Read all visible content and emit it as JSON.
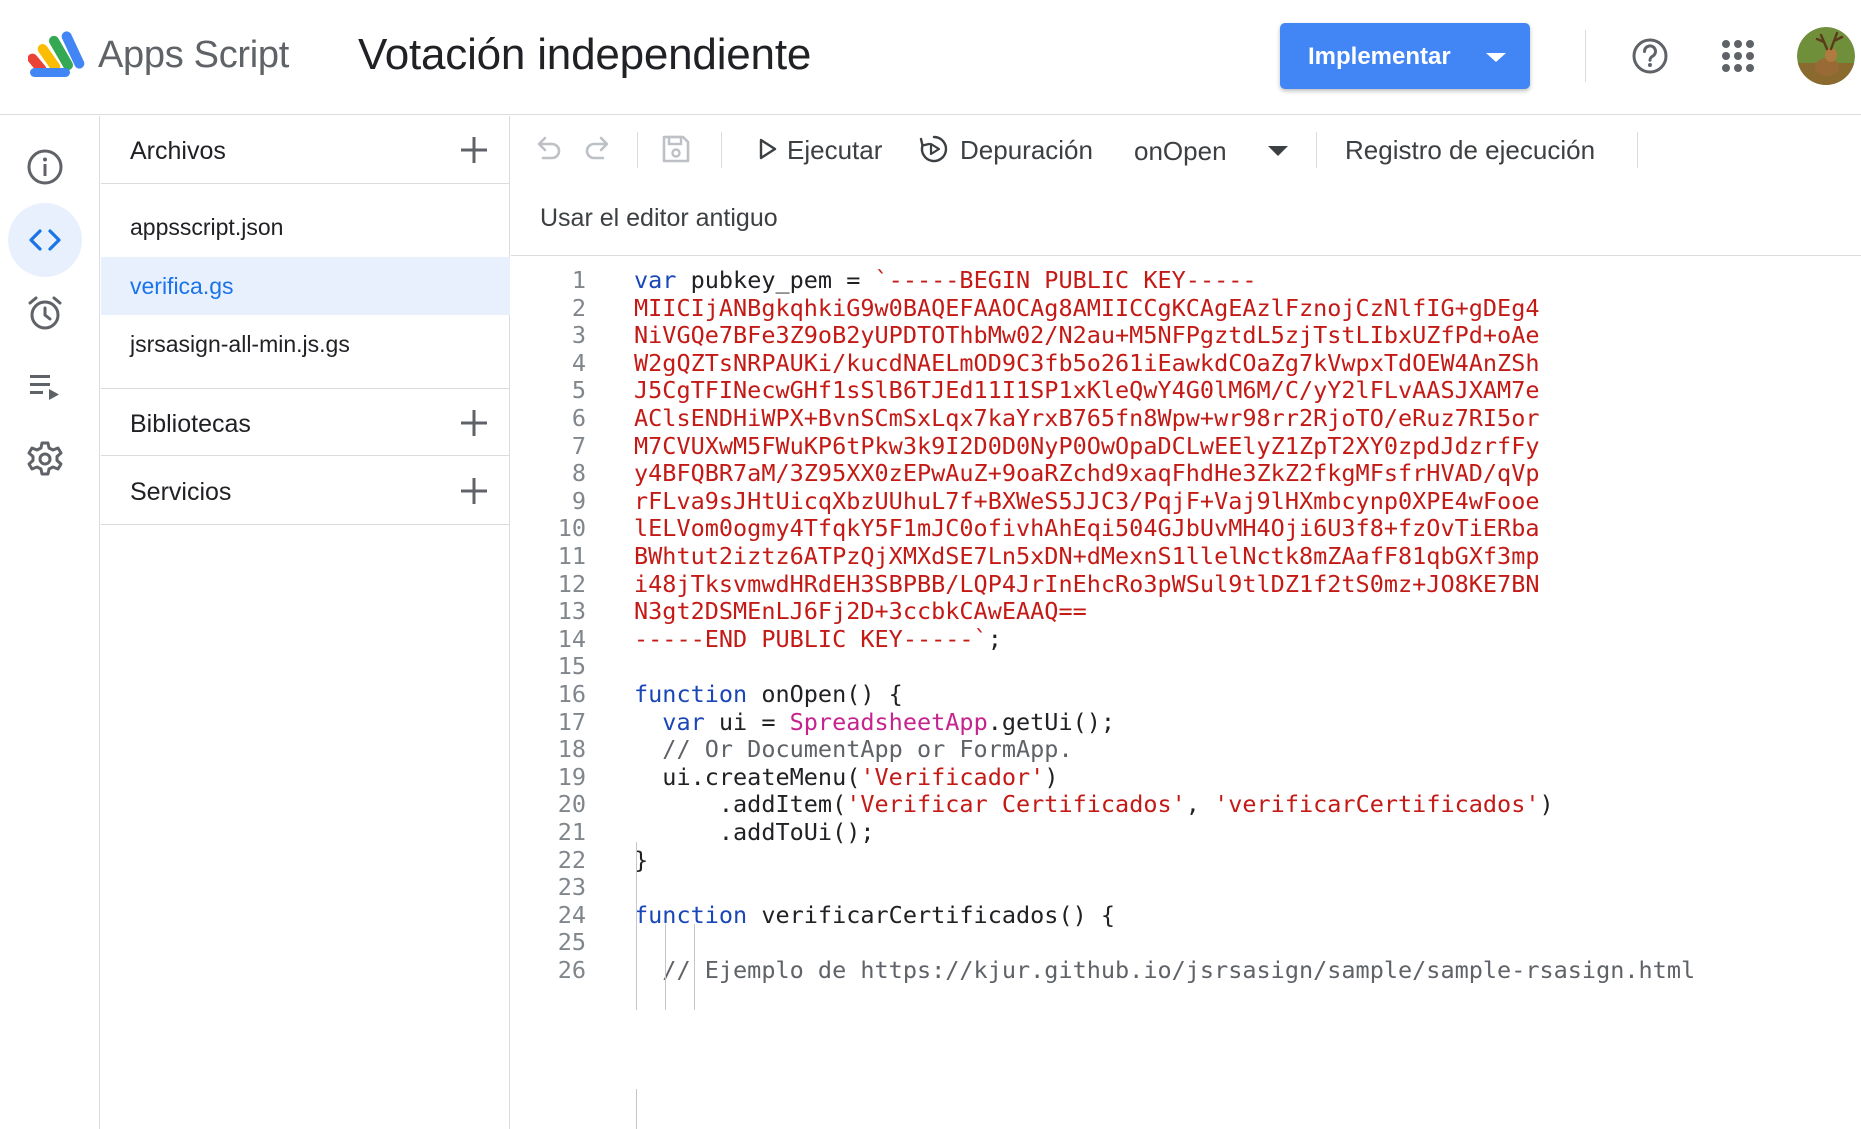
{
  "header": {
    "app_name": "Apps Script",
    "project_title": "Votación independiente",
    "deploy_label": "Implementar"
  },
  "rail": {
    "items": [
      "overview-icon",
      "code-icon",
      "triggers-icon",
      "executions-icon",
      "settings-icon"
    ],
    "active": "code-icon"
  },
  "files_panel": {
    "files_header": "Archivos",
    "files": [
      "appsscript.json",
      "verifica.gs",
      "jsrsasign-all-min.js.gs"
    ],
    "active_file": "verifica.gs",
    "libraries_header": "Bibliotecas",
    "services_header": "Servicios"
  },
  "toolbar": {
    "run_label": "Ejecutar",
    "debug_label": "Depuración",
    "function_select": "onOpen",
    "execution_log_label": "Registro de ejecución",
    "legacy_editor_label": "Usar el editor antiguo"
  },
  "colors": {
    "accent": "#1a73e8",
    "deploy_button": "#4285f4",
    "keyword": "#1a47b8",
    "string": "#c41a16",
    "class": "#c5238e"
  },
  "code": {
    "line_numbers": [
      "1",
      "2",
      "3",
      "4",
      "5",
      "6",
      "7",
      "8",
      "9",
      "10",
      "11",
      "12",
      "13",
      "14",
      "15",
      "16",
      "17",
      "18",
      "19",
      "20",
      "21",
      "22",
      "23",
      "24",
      "25",
      "26"
    ],
    "lines": [
      [
        {
          "t": "var",
          "c": "kw"
        },
        {
          "t": " pubkey_pem = "
        },
        {
          "t": "`-----BEGIN PUBLIC KEY-----",
          "c": "str"
        }
      ],
      [
        {
          "t": "MIICIjANBgkqhkiG9w0BAQEFAAOCAg8AMIICCgKCAgEAzlFznojCzNlfIG+gDEg4",
          "c": "str"
        }
      ],
      [
        {
          "t": "NiVGQe7BFe3Z9oB2yUPDTOThbMw02/N2au+M5NFPgztdL5zjTstLIbxUZfPd+oAe",
          "c": "str"
        }
      ],
      [
        {
          "t": "W2gQZTsNRPAUKi/kucdNAELmOD9C3fb5o261iEawkdCOaZg7kVwpxTdOEW4AnZSh",
          "c": "str"
        }
      ],
      [
        {
          "t": "J5CgTFINecwGHf1sSlB6TJEd11I1SP1xKleQwY4G0lM6M/C/yY2lFLvAASJXAM7e",
          "c": "str"
        }
      ],
      [
        {
          "t": "AClsENDHiWPX+BvnSCmSxLqx7kaYrxB765fn8Wpw+wr98rr2RjoTO/eRuz7RI5or",
          "c": "str"
        }
      ],
      [
        {
          "t": "M7CVUXwM5FWuKP6tPkw3k9I2D0D0NyP0OwOpaDCLwEElyZ1ZpT2XY0zpdJdzrfFy",
          "c": "str"
        }
      ],
      [
        {
          "t": "y4BFQBR7aM/3Z95XX0zEPwAuZ+9oaRZchd9xaqFhdHe3ZkZ2fkgMFsfrHVAD/qVp",
          "c": "str"
        }
      ],
      [
        {
          "t": "rFLva9sJHtUicqXbzUUhuL7f+BXWeS5JJC3/PqjF+Vaj9lHXmbcynp0XPE4wFooe",
          "c": "str"
        }
      ],
      [
        {
          "t": "lELVom0ogmy4TfqkY5F1mJC0ofivhAhEqi504GJbUvMH4Oji6U3f8+fzOvTiERba",
          "c": "str"
        }
      ],
      [
        {
          "t": "BWhtut2iztz6ATPzQjXMXdSE7Ln5xDN+dMexnS1llelNctk8mZAafF81qbGXf3mp",
          "c": "str"
        }
      ],
      [
        {
          "t": "i48jTksvmwdHRdEH3SBPBB/LQP4JrInEhcRo3pWSul9tlDZ1f2tS0mz+JO8KE7BN",
          "c": "str"
        }
      ],
      [
        {
          "t": "N3gt2DSMEnLJ6Fj2D+3ccbkCAwEAAQ==",
          "c": "str"
        }
      ],
      [
        {
          "t": "-----END PUBLIC KEY-----`",
          "c": "str"
        },
        {
          "t": ";"
        }
      ],
      [],
      [
        {
          "t": "function",
          "c": "kw"
        },
        {
          "t": " onOpen() {"
        }
      ],
      [
        {
          "t": "  "
        },
        {
          "t": "var",
          "c": "kw"
        },
        {
          "t": " ui = "
        },
        {
          "t": "SpreadsheetApp",
          "c": "cls"
        },
        {
          "t": ".getUi();"
        }
      ],
      [
        {
          "t": "  // Or DocumentApp or FormApp.",
          "c": "cm"
        }
      ],
      [
        {
          "t": "  ui.createMenu("
        },
        {
          "t": "'Verificador'",
          "c": "str"
        },
        {
          "t": ")"
        }
      ],
      [
        {
          "t": "      .addItem("
        },
        {
          "t": "'Verificar Certificados'",
          "c": "str"
        },
        {
          "t": ", "
        },
        {
          "t": "'verificarCertificados'",
          "c": "str"
        },
        {
          "t": ")"
        }
      ],
      [
        {
          "t": "      .addToUi();"
        }
      ],
      [
        {
          "t": "}"
        }
      ],
      [],
      [
        {
          "t": "function",
          "c": "kw"
        },
        {
          "t": " verificarCertificados() {"
        }
      ],
      [],
      [
        {
          "t": "  // Ejemplo de https://kjur.github.io/jsrsasign/sample/sample-rsasign.html",
          "c": "cm"
        }
      ]
    ]
  }
}
